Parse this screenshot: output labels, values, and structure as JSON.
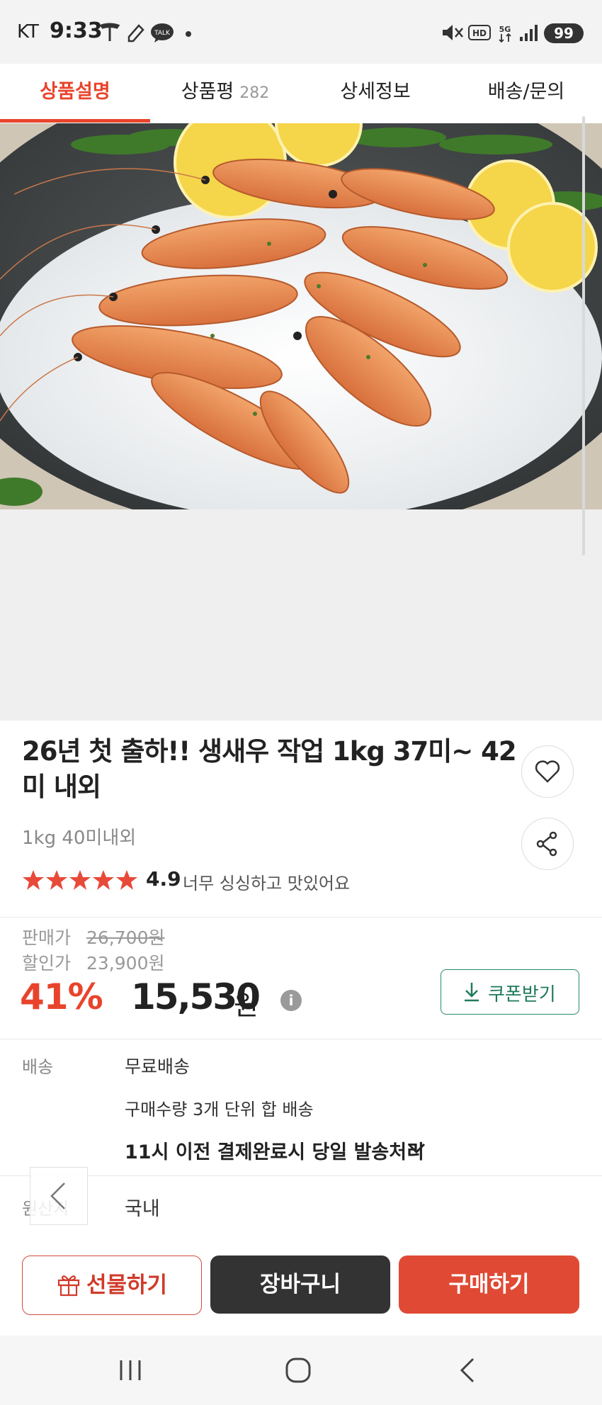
{
  "status_bar": {
    "carrier": "KT",
    "time": "9:33",
    "battery": "99"
  },
  "tabs": [
    {
      "label": "상품설명",
      "active": true
    },
    {
      "label": "상품평",
      "count": "282"
    },
    {
      "label": "상세정보"
    },
    {
      "label": "배송/문의"
    }
  ],
  "product": {
    "title": "26년 첫 출하!! 생새우 작업 1kg 37미~ 42미 내외",
    "subtitle": "1kg 40미내외",
    "rating": "4.9",
    "review_snippet": "너무 싱싱하고 맛있어요"
  },
  "price": {
    "list_label": "판매가",
    "list_price": "26,700원",
    "sale_label": "할인가",
    "sale_price": "23,900원",
    "discount": "41%",
    "final_price": "15,530",
    "final_unit": "원",
    "coupon_label": "쿠폰받기"
  },
  "shipping": {
    "label": "배송",
    "method": "무료배송",
    "bundle": "구매수량 3개 단위 합 배송",
    "fast": "11시 이전 결제완료시 당일 발송처리"
  },
  "origin": {
    "label": "원산지",
    "value": "국내"
  },
  "actions": {
    "gift": "선물하기",
    "cart": "장바구니",
    "buy": "구매하기"
  },
  "colors": {
    "accent": "#e8442c",
    "coupon": "#2a8a68",
    "dark": "#333333",
    "star": "#e84a3a"
  },
  "icons": [
    "tesla-icon",
    "talk-icon",
    "mute-icon",
    "hd-icon",
    "5g-icon",
    "signal-icon",
    "heart-icon",
    "share-icon",
    "info-icon",
    "download-icon",
    "gift-icon",
    "chevron-down-icon",
    "back-icon",
    "recent-apps-icon",
    "home-icon",
    "nav-back-icon"
  ]
}
